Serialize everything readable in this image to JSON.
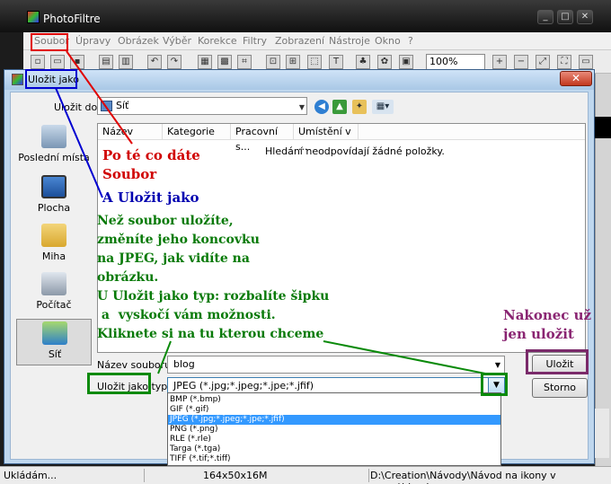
{
  "app": {
    "title": "PhotoFiltre",
    "window_buttons": [
      "_",
      "□",
      "✕"
    ]
  },
  "menu": [
    "Soubor",
    "Úpravy",
    "Obrázek",
    "Výběr",
    "Korekce",
    "Filtry",
    "Zobrazení",
    "Nástroje",
    "Okno",
    "?"
  ],
  "toolbar": {
    "zoom": "100%"
  },
  "dialog": {
    "title": "Uložit jako",
    "save_in_label": "Uložit do:",
    "location": "Síť",
    "places": [
      {
        "label": "Poslední místa",
        "icon": "recent-places-icon"
      },
      {
        "label": "Plocha",
        "icon": "desktop-icon"
      },
      {
        "label": "Miha",
        "icon": "user-folder-icon"
      },
      {
        "label": "Počítač",
        "icon": "computer-icon"
      },
      {
        "label": "Síť",
        "icon": "network-icon"
      }
    ],
    "columns": [
      "Název",
      "Kategorie",
      "Pracovní s...",
      "Umístění v ..."
    ],
    "empty_message": "Hledání neodpovídají žádné položky.",
    "filename_label": "Název souboru:",
    "filename_value": "blog",
    "filetype_label": "Uložit jako typ:",
    "filetype_value": "JPEG (*.jpg;*.jpeg;*.jpe;*.jfif)",
    "save_label": "Uložit",
    "cancel_label": "Storno",
    "filetype_options": [
      "BMP (*.bmp)",
      "GIF (*.gif)",
      "JPEG (*.jpg;*.jpeg;*.jpe;*.jfif)",
      "PNG (*.png)",
      "RLE (*.rle)",
      "Targa (*.tga)",
      "TIFF (*.tif;*.tiff)"
    ],
    "selected_option_index": 2
  },
  "status": {
    "left": "Ukládám...",
    "size": "164x50x16M",
    "path": "D:\\Creation\\Návody\\Návod na ikony v menu\\blog.jpg"
  },
  "annotations": {
    "red": [
      "Po té co dáte",
      "Soubor"
    ],
    "blue": "A Uložit jako",
    "green": [
      "Než soubor uložíte,",
      "změníte jeho koncovku",
      "na JPEG, jak vidíte na",
      "obrázku.",
      "U Uložit jako typ: rozbalíte šipku",
      " a  vyskočí vám možnosti.",
      "Kliknete si na tu kterou chceme"
    ],
    "purple": [
      "Nakonec už",
      "jen uložit"
    ]
  },
  "colors": {
    "red": "#d00000",
    "blue": "#0000b0",
    "green": "#087a08",
    "purple": "#8a2572"
  }
}
